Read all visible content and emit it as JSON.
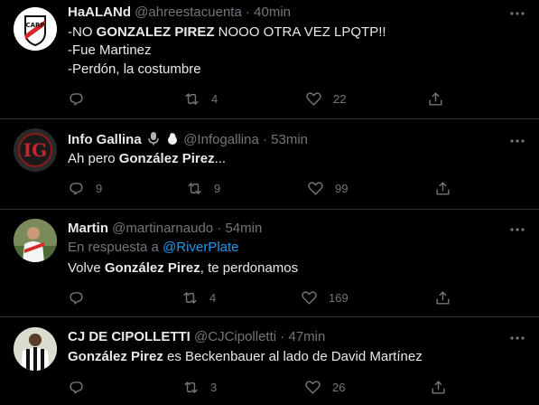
{
  "tweets": [
    {
      "name": "HaALANd",
      "handle": "@ahreestacuenta",
      "separator": "·",
      "time": "40min",
      "lines": [
        {
          "parts": [
            {
              "t": "-NO ",
              "b": false
            },
            {
              "t": "GONZALEZ PIREZ",
              "b": true
            },
            {
              "t": " NOOO OTRA VEZ LPQTP!!",
              "b": false
            }
          ]
        },
        {
          "parts": [
            {
              "t": "-Fue Martinez",
              "b": false
            }
          ]
        },
        {
          "parts": [
            {
              "t": "-Perdón, la costumbre",
              "b": false
            }
          ]
        }
      ],
      "replies": "",
      "retweets": "4",
      "likes": "22",
      "avatar": "river-plate-crest"
    },
    {
      "name": "Info Gallina",
      "handle": "@Infogallina",
      "separator": "·",
      "time": "53min",
      "lines": [
        {
          "parts": [
            {
              "t": "Ah pero ",
              "b": false
            },
            {
              "t": "González Pirez",
              "b": true
            },
            {
              "t": "...",
              "b": false
            }
          ]
        }
      ],
      "replies": "9",
      "retweets": "9",
      "likes": "99",
      "avatar": "ig-logo",
      "name_badges": [
        "microphone-emoji",
        "rooster-emoji"
      ]
    },
    {
      "name": "Martin",
      "handle": "@martinarnaudo",
      "separator": "·",
      "time": "54min",
      "reply_prefix": "En respuesta a ",
      "reply_to": "@RiverPlate",
      "lines": [
        {
          "parts": [
            {
              "t": "Volve ",
              "b": false
            },
            {
              "t": "González Pirez",
              "b": true
            },
            {
              "t": ", te perdonamos",
              "b": false
            }
          ]
        }
      ],
      "replies": "",
      "retweets": "4",
      "likes": "169",
      "avatar": "player-photo"
    },
    {
      "name": "CJ DE CIPOLLETTI",
      "handle": "@CJCipolletti",
      "separator": "·",
      "time": "47min",
      "lines": [
        {
          "parts": [
            {
              "t": "González Pirez",
              "b": true
            },
            {
              "t": " es Beckenbauer al lado de David Martínez",
              "b": false
            }
          ]
        }
      ],
      "replies": "",
      "retweets": "3",
      "likes": "26",
      "avatar": "striped-jersey-player"
    }
  ],
  "colors": {
    "background": "#000000",
    "text": "#e7e9ea",
    "muted": "#71767b",
    "link": "#1d9bf0",
    "divider": "#2f3336"
  }
}
